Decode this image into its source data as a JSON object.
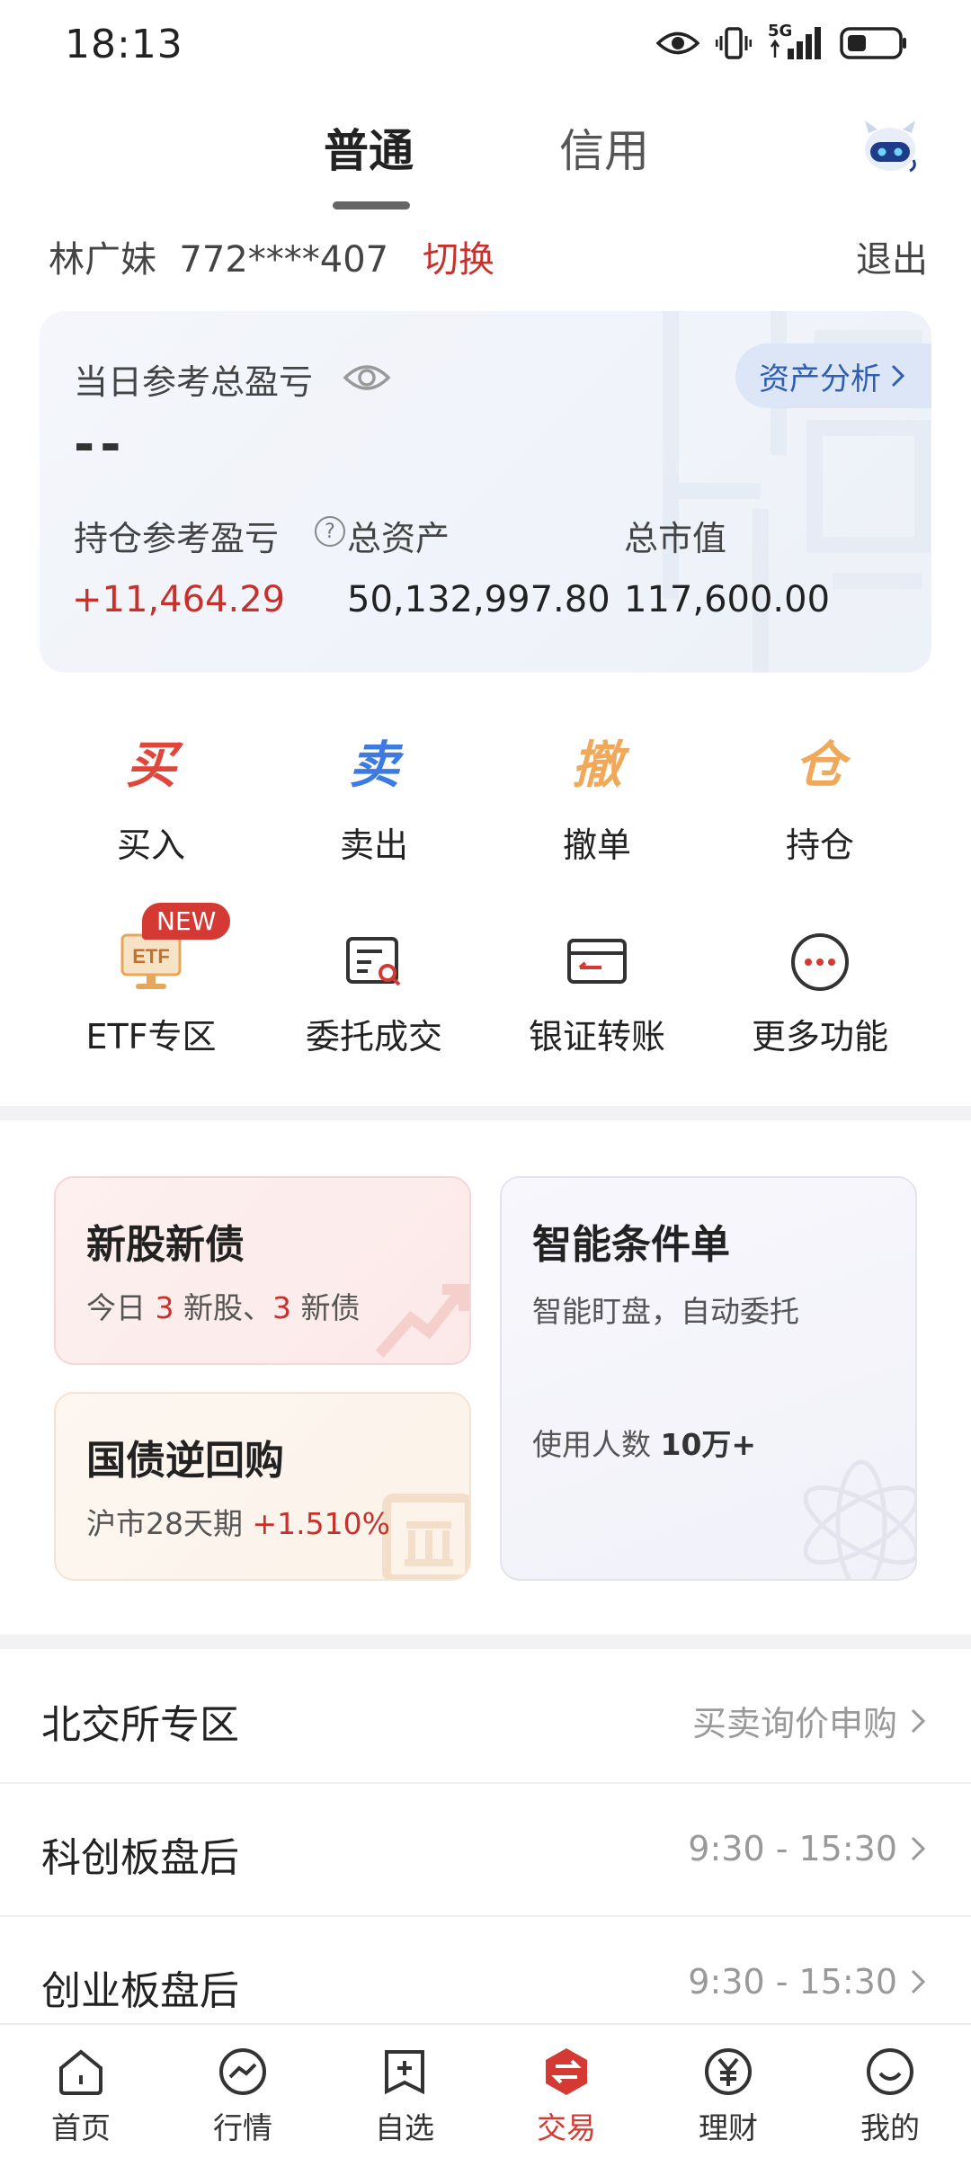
{
  "status_bar": {
    "time": "18:13",
    "network": "5G"
  },
  "tabs": [
    {
      "label": "普通",
      "active": true
    },
    {
      "label": "信用",
      "active": false
    }
  ],
  "account": {
    "name_id": "林广妹  772****407",
    "switch_label": "切换",
    "logout_label": "退出"
  },
  "asset_card": {
    "title": "当日参考总盈亏",
    "value": "--",
    "analysis_button": "资产分析",
    "holding_pnl_label": "持仓参考盈亏",
    "holding_pnl_value": "+11,464.29",
    "total_assets_label": "总资产",
    "total_assets_value": "50,132,997.80",
    "market_value_label": "总市值",
    "market_value_value": "117,600.00"
  },
  "quick_actions": [
    {
      "glyph": "买",
      "label": "买入",
      "color": "#e0473a"
    },
    {
      "glyph": "卖",
      "label": "卖出",
      "color": "#3d7be0"
    },
    {
      "glyph": "撤",
      "label": "撤单",
      "color": "#f0a85a"
    },
    {
      "glyph": "仓",
      "label": "持仓",
      "color": "#f0a85a"
    }
  ],
  "tools": [
    {
      "label": "ETF专区",
      "icon": "etf-monitor-icon",
      "badge": "NEW",
      "icon_text": "ETF"
    },
    {
      "label": "委托成交",
      "icon": "order-search-icon"
    },
    {
      "label": "银证转账",
      "icon": "bank-card-icon"
    },
    {
      "label": "更多功能",
      "icon": "more-dots-icon"
    }
  ],
  "promos": {
    "ipo": {
      "title": "新股新债",
      "prefix": "今日 ",
      "stock_count": "3",
      "mid": " 新股、",
      "bond_count": "3",
      "suffix": " 新债"
    },
    "repo": {
      "title": "国债逆回购",
      "sub": "沪市28天期 ",
      "rate": "+1.510%"
    },
    "smart": {
      "title": "智能条件单",
      "sub": "智能盯盘，自动委托",
      "users_label": "使用人数 ",
      "users_value": "10万+"
    }
  },
  "list": [
    {
      "title": "北交所专区",
      "right": "买卖询价申购"
    },
    {
      "title": "科创板盘后",
      "right": "9:30 - 15:30"
    },
    {
      "title": "创业板盘后",
      "right": "9:30 - 15:30"
    }
  ],
  "bottom_nav": [
    {
      "label": "首页",
      "icon": "home-icon",
      "active": false
    },
    {
      "label": "行情",
      "icon": "market-icon",
      "active": false
    },
    {
      "label": "自选",
      "icon": "watchlist-add-icon",
      "active": false
    },
    {
      "label": "交易",
      "icon": "trade-icon",
      "active": true
    },
    {
      "label": "理财",
      "icon": "yen-icon",
      "active": false
    },
    {
      "label": "我的",
      "icon": "profile-icon",
      "active": false
    }
  ],
  "colors": {
    "accent_red": "#d43a33",
    "blue": "#3d7be0",
    "orange": "#f0a85a"
  }
}
